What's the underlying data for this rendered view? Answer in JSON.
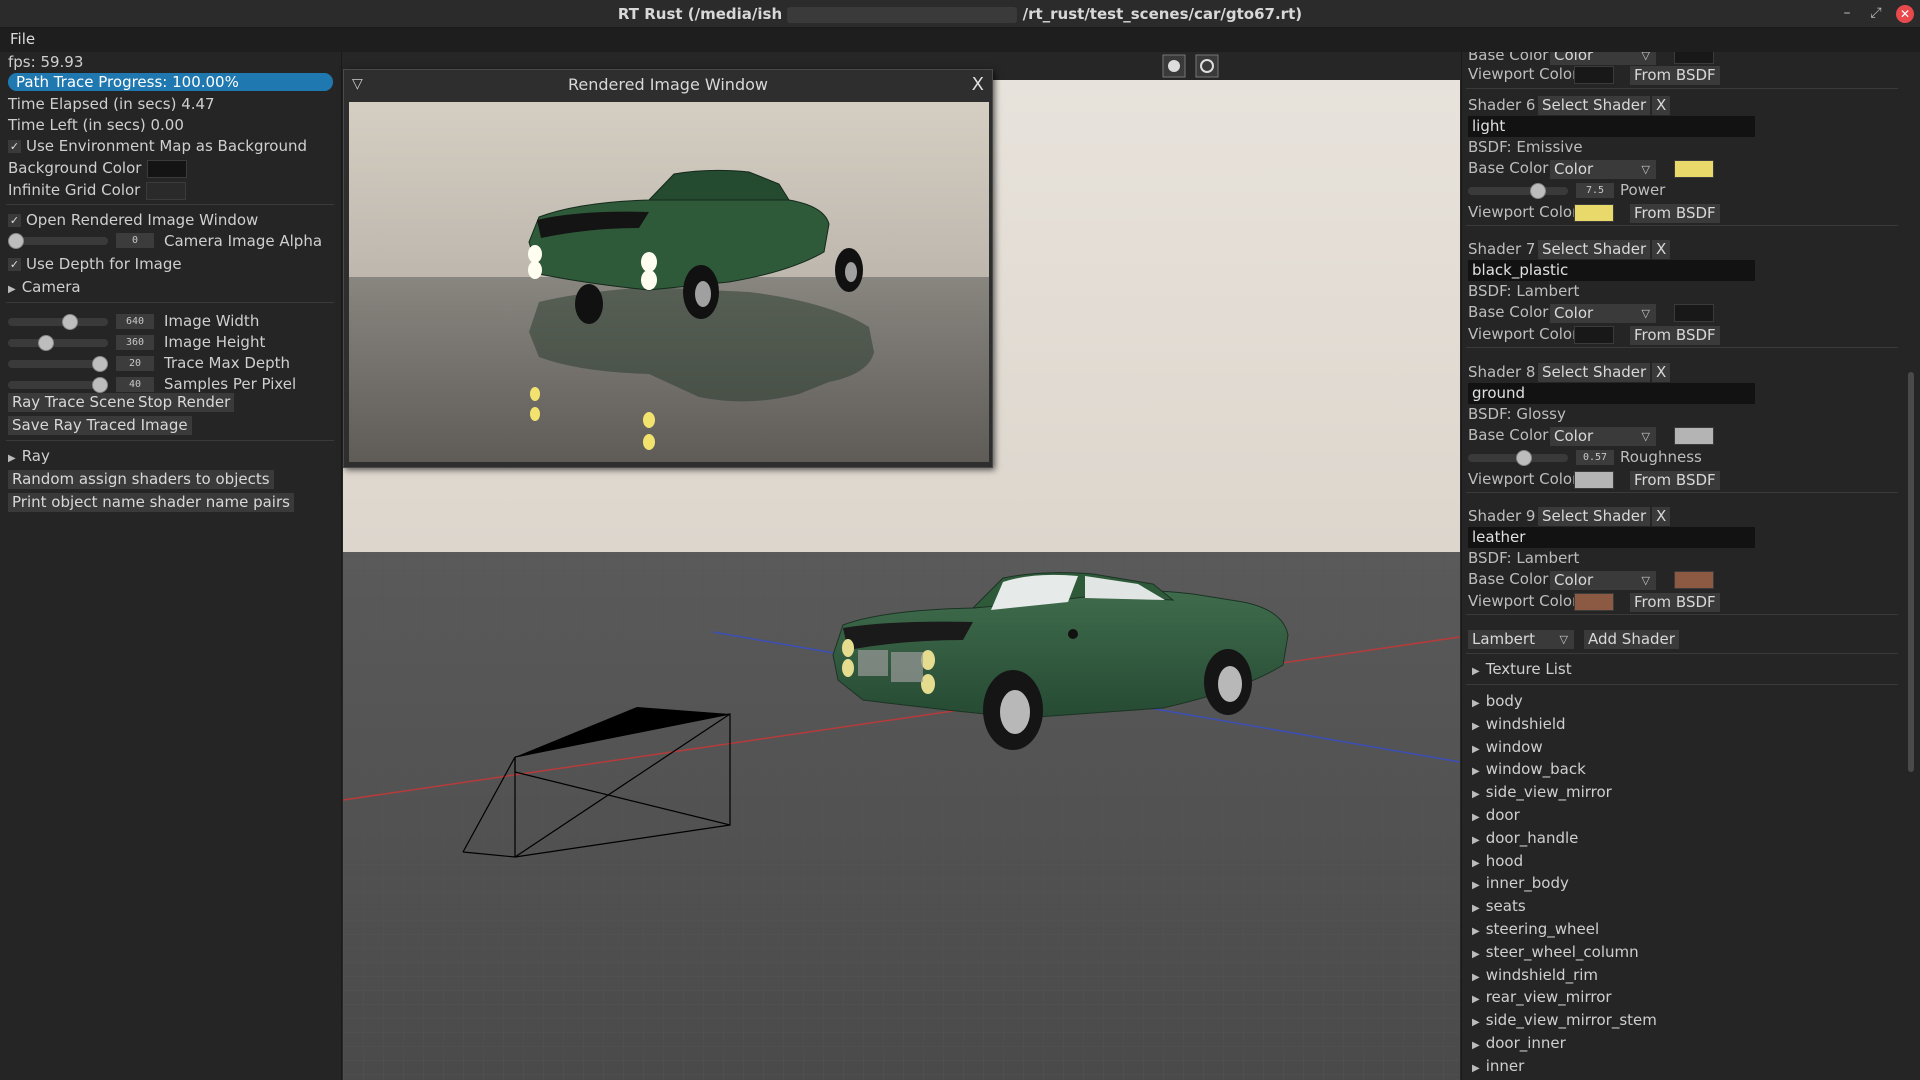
{
  "window": {
    "title_prefix": "RT Rust (/media/ish",
    "title_suffix": "/rt_rust/test_scenes/car/gto67.rt)"
  },
  "menubar": {
    "file": "File"
  },
  "left": {
    "fps": "fps: 59.93",
    "progress_label": "Path Trace Progress: 100.00%",
    "progress_value": 1.0,
    "time_elapsed": "Time Elapsed (in secs) 4.47",
    "time_left": "Time Left (in secs) 0.00",
    "use_env_map": "Use Environment Map as Background",
    "background_color": "Background Color",
    "infinite_grid_color": "Infinite Grid Color",
    "open_render_window": "Open Rendered Image Window",
    "camera_alpha_value": "0",
    "camera_alpha_label": "Camera Image Alpha",
    "use_depth": "Use Depth for Image",
    "camera": "Camera",
    "image_width_value": "640",
    "image_width_label": "Image Width",
    "image_height_value": "360",
    "image_height_label": "Image Height",
    "trace_depth_value": "20",
    "trace_depth_label": "Trace Max Depth",
    "spp_value": "40",
    "spp_label": "Samples Per Pixel",
    "ray_trace_scene": "Ray Trace Scene",
    "stop_render": "Stop Render",
    "save_image": "Save Ray Traced Image",
    "ray": "Ray",
    "random_assign": "Random assign shaders to objects",
    "print_pairs": "Print object name shader name pairs"
  },
  "render_window": {
    "title": "Rendered Image Window",
    "close": "X"
  },
  "right": {
    "top_base_color": "Base Color",
    "top_color_drop": "Color",
    "viewport_color": "Viewport Color",
    "from_bsdf": "From BSDF",
    "select_shader": "Select Shader",
    "x": "X",
    "base_color": "Base Color",
    "color": "Color",
    "shaders": [
      {
        "label": "Shader 6",
        "name": "light",
        "bsdf": "BSDF: Emissive",
        "base_swatch": "#e8d96a",
        "viewport_swatch": "#e8d96a",
        "extra_value": "7.5",
        "extra_label": "Power"
      },
      {
        "label": "Shader 7",
        "name": "black_plastic",
        "bsdf": "BSDF: Lambert",
        "base_swatch": "#181818",
        "viewport_swatch": "#181818"
      },
      {
        "label": "Shader 8",
        "name": "ground",
        "bsdf": "BSDF: Glossy",
        "base_swatch": "#b4b4b4",
        "viewport_swatch": "#b4b4b4",
        "extra_value": "0.57",
        "extra_label": "Roughness"
      },
      {
        "label": "Shader 9",
        "name": "leather",
        "bsdf": "BSDF: Lambert",
        "base_swatch": "#8c5a42",
        "viewport_swatch": "#8c5a42"
      }
    ],
    "new_shader_type": "Lambert",
    "add_shader": "Add Shader",
    "texture_list": "Texture List",
    "objects": [
      "body",
      "windshield",
      "window",
      "window_back",
      "side_view_mirror",
      "door",
      "door_handle",
      "hood",
      "inner_body",
      "seats",
      "steering_wheel",
      "steer_wheel_column",
      "windshield_rim",
      "rear_view_mirror",
      "side_view_mirror_stem",
      "door_inner",
      "inner"
    ]
  },
  "colors": {
    "accent": "#1f78b0",
    "panel": "#252525",
    "car_green": "#2f5a3a"
  }
}
